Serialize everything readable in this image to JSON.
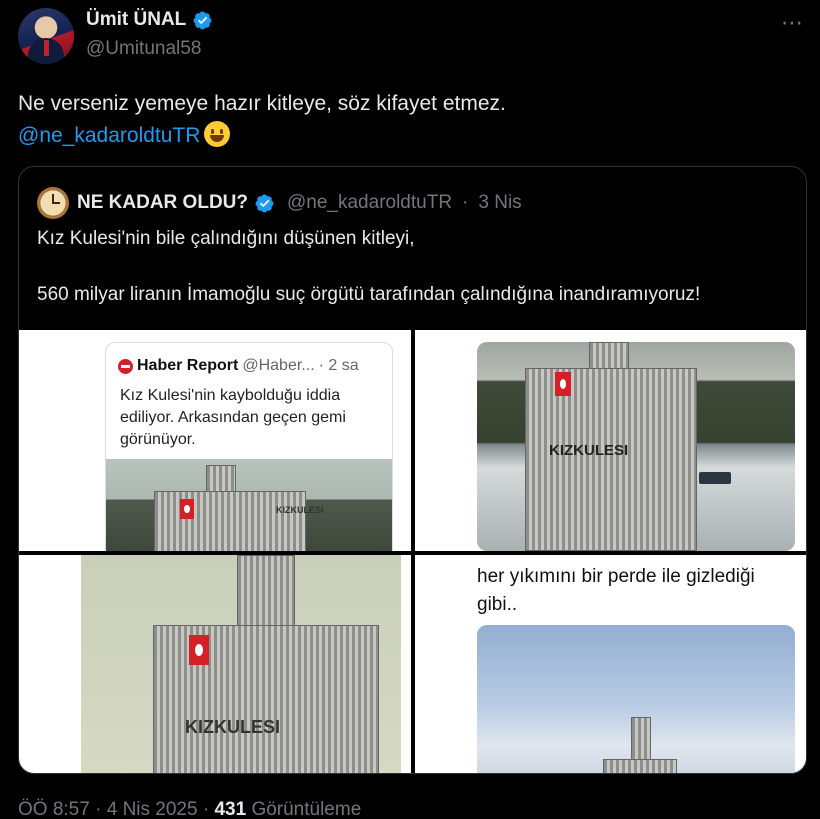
{
  "author": {
    "display_name": "Ümit ÜNAL",
    "handle": "@Umitunal58"
  },
  "more_icon": "⋯",
  "tweet_text": {
    "line1": "Ne verseniz yemeye hazır kitleye, söz kifayet etmez.",
    "mention": "@ne_kadaroldtuTR"
  },
  "quote": {
    "display_name": "NE KADAR OLDU?",
    "handle": "@ne_kadaroldtuTR",
    "separator": "·",
    "date": "3 Nis",
    "text_line1": "Kız Kulesi'nin bile çalındığını düşünen kitleyi,",
    "text_line2": "560 milyar liranın İmamoğlu suç örgütü tarafından çalındığına inandıramıyoruz!"
  },
  "media": {
    "cell1": {
      "inner_author": "Haber Report",
      "inner_handle": "@Haber...",
      "inner_date": "· 2 sa",
      "inner_text": "Kız Kulesi'nin kaybolduğu iddia ediliyor. Arkasından geçen gemi görünüyor.",
      "image_text": "KIZKULESI"
    },
    "cell2": {
      "image_text": "KIZKULESI"
    },
    "cell3": {
      "image_text": "KIZKULESI"
    },
    "cell4": {
      "text": "her yıkımını bir perde ile gizlediği gibi.."
    }
  },
  "footer": {
    "time": "ÖÖ 8:57",
    "sep1": "·",
    "date": "4 Nis 2025",
    "sep2": "·",
    "views_count": "431",
    "views_label": "Görüntüleme"
  },
  "colors": {
    "background": "#000000",
    "link": "#1d9bf0",
    "muted": "#71767b",
    "verified": "#1d9bf0"
  }
}
